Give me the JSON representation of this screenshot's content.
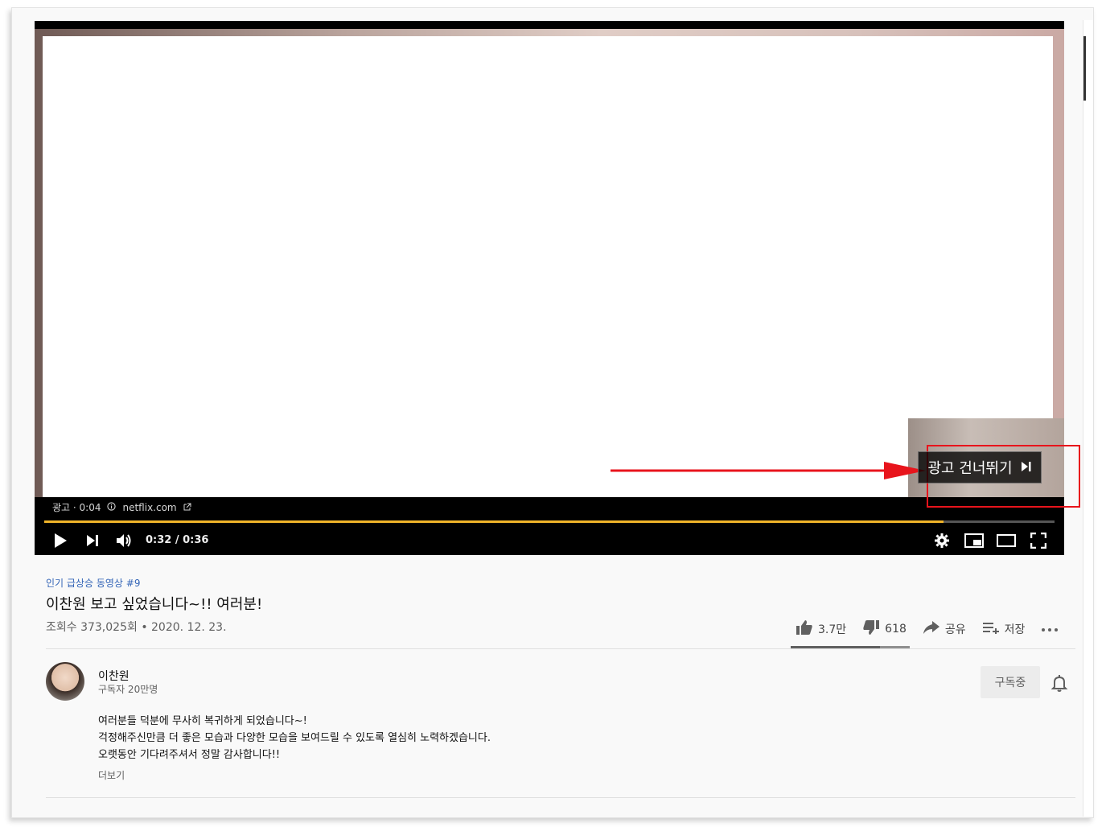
{
  "player": {
    "ad_label": "광고 · 0:04",
    "ad_domain": "netflix.com",
    "time": "0:32 / 0:36",
    "progress_fraction": 0.89,
    "skip_label": "광고 건너뛰기",
    "accent_color": "#f0b429",
    "highlight_color": "#e8141c"
  },
  "video": {
    "hashtag": "인기 급상승 동영상 #9",
    "title": "이찬원 보고 싶었습니다~!! 여러분!",
    "meta": "조회수 373,025회 • 2020. 12. 23."
  },
  "actions": {
    "like": "3.7만",
    "dislike": "618",
    "share": "공유",
    "save": "저장",
    "like_ratio": 0.75
  },
  "channel": {
    "name": "이찬원",
    "subscribers": "구독자 20만명",
    "subscribed_label": "구독중"
  },
  "description": {
    "lines": [
      "여러분들 덕분에 무사히 복귀하게 되었습니다~!",
      "걱정해주신만큼 더 좋은 모습과 다양한 모습을 보여드릴 수 있도록 열심히 노력하겠습니다.",
      "오랫동안 기다려주셔서 정말 감사합니다!!"
    ],
    "more_label": "더보기"
  },
  "icons": [
    "play-icon",
    "next-icon",
    "volume-icon",
    "settings-icon",
    "miniplayer-icon",
    "theater-icon",
    "fullscreen-icon",
    "info-icon",
    "external-link-icon",
    "skip-icon",
    "like-icon",
    "dislike-icon",
    "share-icon",
    "save-icon",
    "more-icon",
    "bell-icon"
  ]
}
